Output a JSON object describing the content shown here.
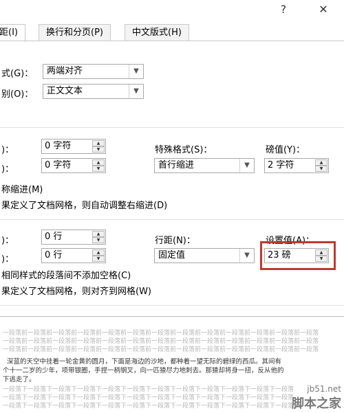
{
  "titlebar": {
    "help": "?",
    "close": "✕"
  },
  "tabs": [
    {
      "label": "距(I)"
    },
    {
      "label": "换行和分页(P)"
    },
    {
      "label": "中文版式(H)"
    }
  ],
  "general": {
    "alignment_label": "式(G)：",
    "alignment_value": "两端对齐",
    "outline_label": "别(O)：",
    "outline_value": "正文文本"
  },
  "indent": {
    "left_label": ")：",
    "left_value": "0 字符",
    "right_label": ")：",
    "right_value": "0 字符",
    "special_label": "特殊格式(S)：",
    "special_value": "首行缩进",
    "by_label": "磅值(Y)：",
    "by_value": "2 字符",
    "mirror": "称缩进(M)",
    "auto_adjust": "果定义了文档网格，则自动调整右缩进(D)"
  },
  "spacing": {
    "before_label": ")：",
    "before_value": "0 行",
    "after_label": ")：",
    "after_value": "0 行",
    "line_label": "行距(N)：",
    "line_value": "固定值",
    "at_label": "设置值(A)：",
    "at_value": "23 磅",
    "no_space": "相同样式的段落间不添加空格(C)",
    "snap_grid": "果定义了文档网格，则对齐到网格(W)"
  },
  "preview": {
    "prev_line": "一段落前一段落前一段落前一段落前一段落前一段落前一段落前一段落前一段落前一段落前一段落前一段落前一段落",
    "main_line1": "深蓝的天空中挂着一轮金黄的圆月，下面是海边的沙地，都种着一望无际的碧绿的西瓜。其间有",
    "main_line2": "个十一二岁的少年，项带银圈，手捏一柄钢叉，向一匹猹尽力地刺去。那猹却将身一扭，反从他的",
    "main_line3": "下逃走了。",
    "next_line": "一段落下一段落下一段落下一段落下一段落下一段落下一段落下一段落下一段落下一段落下一段落下一段落"
  },
  "watermark": {
    "site": "jb51.net",
    "brand": "脚本之家"
  },
  "colors": {
    "highlight": "#c0392b"
  }
}
